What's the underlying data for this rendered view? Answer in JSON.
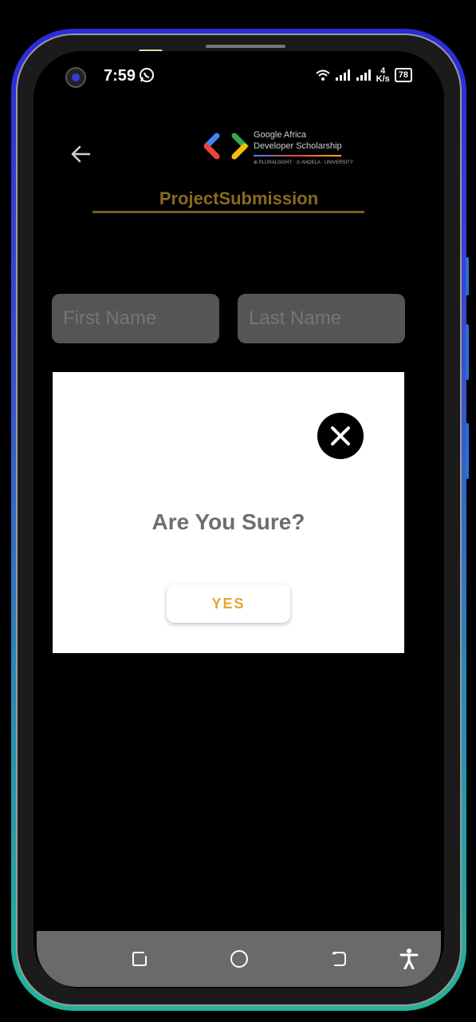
{
  "status_bar": {
    "time": "7:59",
    "net_speed_value": "4",
    "net_speed_unit": "K/s",
    "battery": "78"
  },
  "header": {
    "logo_line1": "Google Africa",
    "logo_line2": "Developer Scholarship",
    "logo_partners": "⊕ PLURALSIGHT · ⊙ ANDELA · UNIVERSITY",
    "title": "ProjectSubmission"
  },
  "form": {
    "first_name_placeholder": "First Name",
    "last_name_placeholder": "Last Name"
  },
  "dialog": {
    "message": "Are You Sure?",
    "yes_label": "YES"
  },
  "colors": {
    "title": "#8a6a1c",
    "yes_text": "#e3a72b",
    "dialog_bg": "#ffffff",
    "input_bg": "#555555"
  },
  "icons": {
    "back": "arrow-left-icon",
    "close": "close-icon",
    "nav_recents": "recents-icon",
    "nav_home": "home-icon",
    "nav_back": "back-nav-icon",
    "accessibility": "accessibility-icon"
  }
}
